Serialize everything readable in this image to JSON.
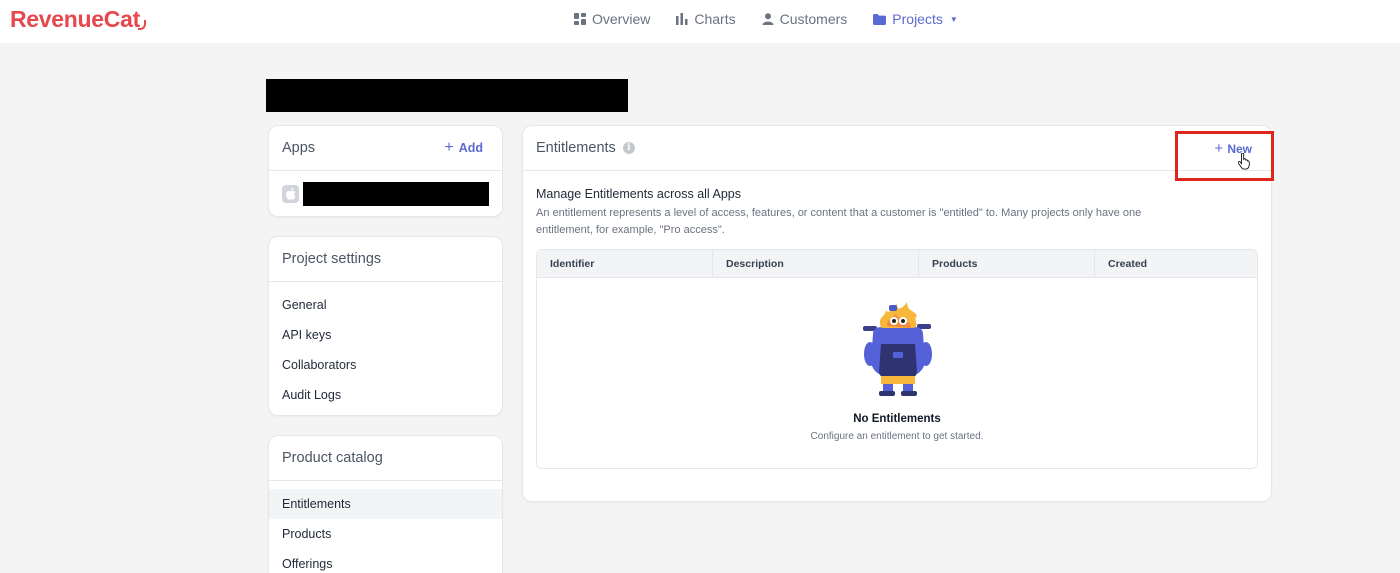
{
  "brand": {
    "name": "RevenueCat",
    "color": "#e5484d"
  },
  "nav": {
    "items": [
      {
        "label": "Overview",
        "icon": "grid-icon"
      },
      {
        "label": "Charts",
        "icon": "bar-chart-icon"
      },
      {
        "label": "Customers",
        "icon": "person-icon"
      },
      {
        "label": "Projects",
        "icon": "folder-icon",
        "active": true
      }
    ]
  },
  "apps": {
    "title": "Apps",
    "add_label": "Add"
  },
  "project_settings": {
    "title": "Project settings",
    "items": [
      "General",
      "API keys",
      "Collaborators",
      "Audit Logs"
    ]
  },
  "product_catalog": {
    "title": "Product catalog",
    "items": [
      "Entitlements",
      "Products",
      "Offerings"
    ],
    "selected": "Entitlements"
  },
  "entitlements": {
    "title": "Entitlements",
    "new_label": "New",
    "lead": "Manage Entitlements across all Apps",
    "description": "An entitlement represents a level of access, features, or content that a customer is \"entitled\" to. Many projects only have one entitlement, for example, \"Pro access\".",
    "columns": [
      "Identifier",
      "Description",
      "Products",
      "Created"
    ],
    "empty_title": "No Entitlements",
    "empty_subtitle": "Configure an entitlement to get started."
  },
  "colors": {
    "accent": "#5b6ad0",
    "highlight": "#e0261a",
    "background": "#f4f4f5"
  }
}
